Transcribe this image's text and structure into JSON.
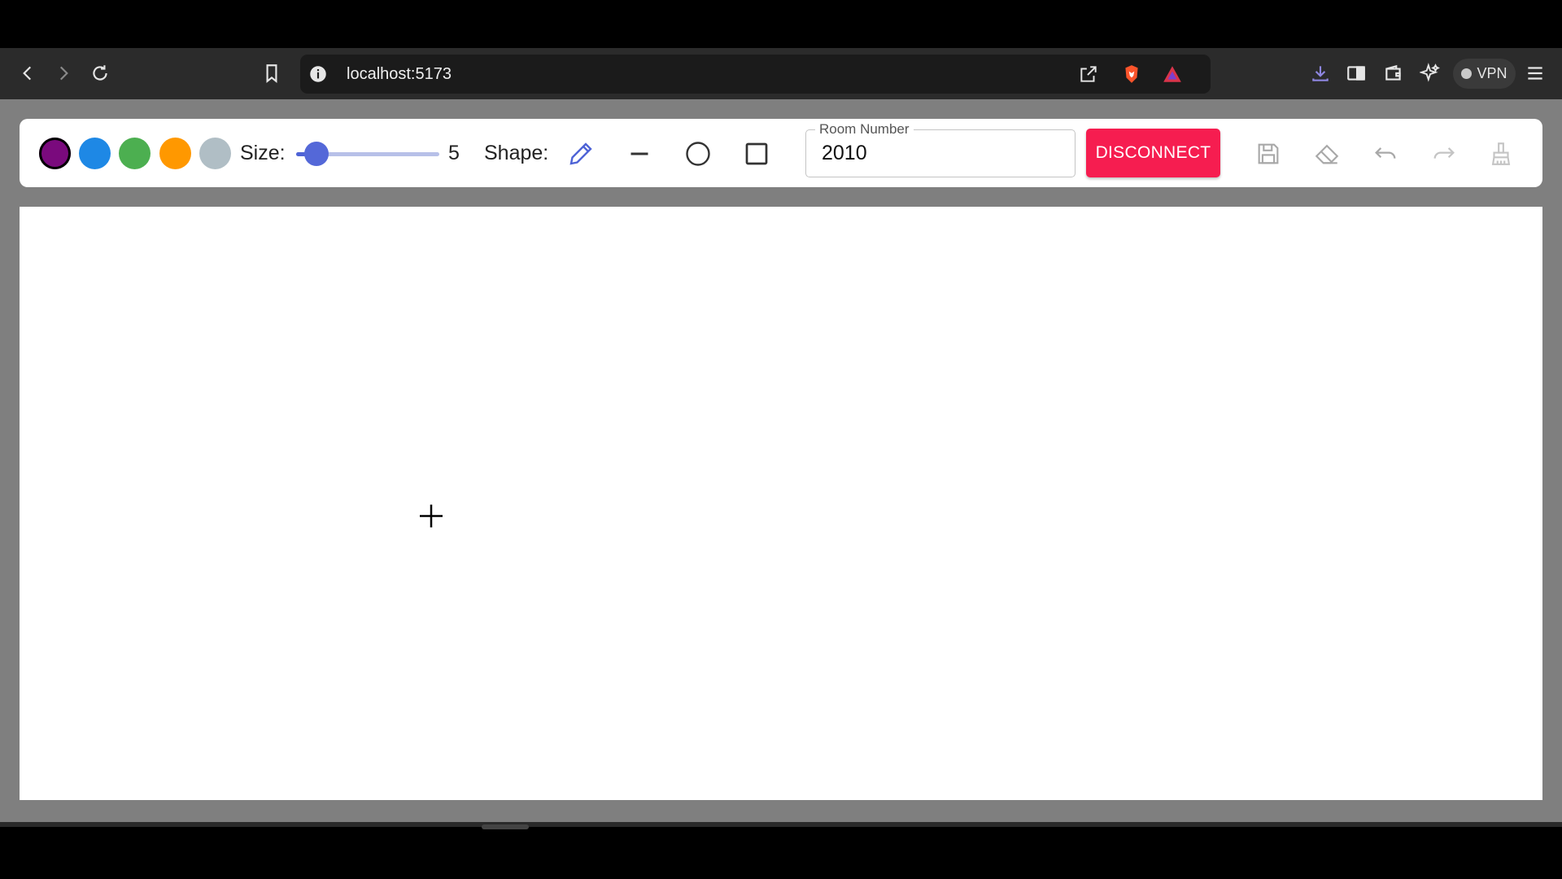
{
  "browser": {
    "url": "localhost:5173",
    "vpn_label": "VPN",
    "icons": [
      "back-icon",
      "forward-icon",
      "reload-icon",
      "bookmark-icon",
      "site-info-icon",
      "share-icon",
      "brave-shields-icon",
      "brave-rewards-icon",
      "download-icon",
      "sidebar-icon",
      "wallet-icon",
      "leo-ai-icon",
      "menu-icon"
    ]
  },
  "toolbar": {
    "colors": [
      "#7a0a7d",
      "#1e88e5",
      "#4caf50",
      "#ff9800",
      "#b0bec5"
    ],
    "selected_color": "#7a0a7d",
    "size_label": "Size:",
    "size_value": "5",
    "size_min": 1,
    "size_max": 50,
    "shape_label": "Shape:",
    "shapes": [
      "pencil-icon",
      "line-icon",
      "circle-icon",
      "rectangle-icon"
    ],
    "selected_shape": "pencil-icon",
    "room_label": "Room Number",
    "room_value": "2010",
    "disconnect_label": "DISCONNECT",
    "accent": "#f61d50",
    "actions": [
      "save-icon",
      "eraser-icon",
      "undo-icon",
      "redo-icon",
      "clear-brush-icon"
    ]
  }
}
